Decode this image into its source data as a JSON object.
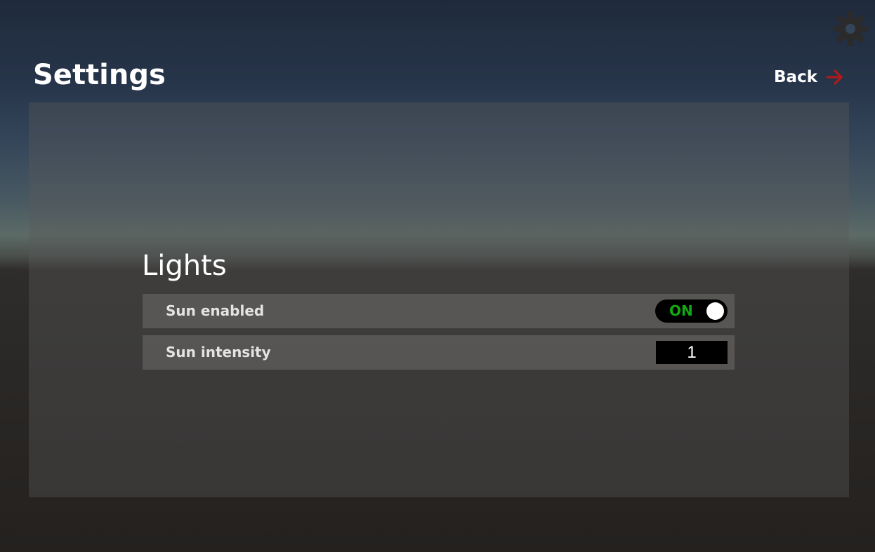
{
  "header": {
    "title": "Settings",
    "back_label": "Back"
  },
  "icons": {
    "back": "arrow-right-icon",
    "settings": "gear-icon"
  },
  "colors": {
    "back_arrow": "#b01a1a",
    "toggle_on_text": "#12a812",
    "gear": "#2b2b2b"
  },
  "lights": {
    "section_title": "Lights",
    "sun_enabled": {
      "label": "Sun enabled",
      "state_text": "ON",
      "value": true
    },
    "sun_intensity": {
      "label": "Sun intensity",
      "value": "1"
    }
  }
}
